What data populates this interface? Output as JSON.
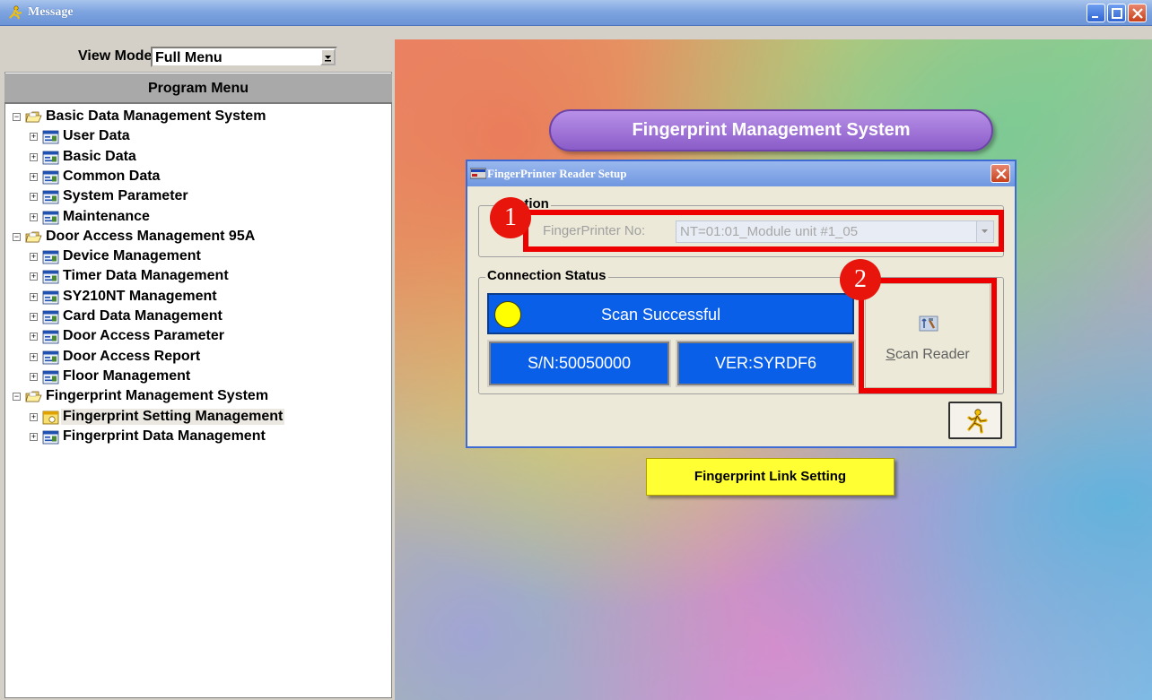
{
  "window": {
    "title": "Message",
    "title_icon": "running-person-icon",
    "controls": [
      "minimize",
      "maximize",
      "close"
    ]
  },
  "left_panel": {
    "view_mode_label": "View Mode:",
    "view_mode_value": "Full Menu",
    "program_menu_header": "Program Menu",
    "tree": [
      {
        "label": "Basic Data Management System",
        "level": 0,
        "expander": "−",
        "icon": "folder-open-icon"
      },
      {
        "label": "User Data",
        "level": 1,
        "expander": "+",
        "icon": "form-window-icon"
      },
      {
        "label": "Basic Data",
        "level": 1,
        "expander": "+",
        "icon": "form-window-icon"
      },
      {
        "label": "Common Data",
        "level": 1,
        "expander": "+",
        "icon": "form-window-icon"
      },
      {
        "label": "System Parameter",
        "level": 1,
        "expander": "+",
        "icon": "form-window-icon"
      },
      {
        "label": "Maintenance",
        "level": 1,
        "expander": "+",
        "icon": "form-window-icon"
      },
      {
        "label": "Door Access Management 95A",
        "level": 0,
        "expander": "−",
        "icon": "folder-open-icon"
      },
      {
        "label": "Device Management",
        "level": 1,
        "expander": "+",
        "icon": "form-window-icon"
      },
      {
        "label": "Timer Data Management",
        "level": 1,
        "expander": "+",
        "icon": "form-window-icon"
      },
      {
        "label": "SY210NT Management",
        "level": 1,
        "expander": "+",
        "icon": "form-window-icon"
      },
      {
        "label": "Card Data Management",
        "level": 1,
        "expander": "+",
        "icon": "form-window-icon"
      },
      {
        "label": "Door Access Parameter",
        "level": 1,
        "expander": "+",
        "icon": "form-window-icon"
      },
      {
        "label": "Door Access Report",
        "level": 1,
        "expander": "+",
        "icon": "form-window-icon"
      },
      {
        "label": "Floor Management",
        "level": 1,
        "expander": "+",
        "icon": "form-window-icon"
      },
      {
        "label": "Fingerprint Management System",
        "level": 0,
        "expander": "−",
        "icon": "folder-open-icon"
      },
      {
        "label": "Fingerprint Setting Management",
        "level": 1,
        "expander": "+",
        "icon": "form-window-active-icon",
        "selected": true
      },
      {
        "label": "Fingerprint Data Management",
        "level": 1,
        "expander": "+",
        "icon": "form-window-icon"
      }
    ]
  },
  "main": {
    "banner": "Fingerprint Management System",
    "link_button": "Fingerprint Link Setting"
  },
  "dialog": {
    "title": "FingerPrinter Reader Setup",
    "group_connection": "ction",
    "fp_label": "FingerPrinter No:",
    "fp_value": "NT=01:01_Module unit #1_05",
    "group_status": "Connection Status",
    "status_text": "Scan Successful",
    "sn": "S/N:50050000",
    "ver": "VER:SYRDF6",
    "scan_button_underline": "S",
    "scan_button_rest": "can Reader",
    "exit_icon": "running-person-icon"
  },
  "annotations": {
    "marker1": "1",
    "marker2": "2",
    "highlight_color": "#ee0000"
  },
  "colors": {
    "status_blue": "#0a5fe8",
    "status_dot": "#ffff00",
    "banner_purple": "#9a6ad4",
    "link_yellow": "#ffff33"
  }
}
